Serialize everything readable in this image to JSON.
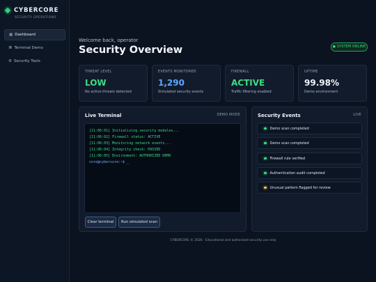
{
  "brand": {
    "name": "CYBERCORE",
    "subtitle": "SECURITY OPERATIONS",
    "accent": "#2bd27e"
  },
  "sidebar": {
    "items": [
      {
        "icon": "▦",
        "label": "Dashboard",
        "active": true
      },
      {
        "icon": "⌘",
        "label": "Terminal Demo",
        "active": false
      },
      {
        "icon": "⚙",
        "label": "Security Tools",
        "active": false
      }
    ]
  },
  "header": {
    "welcome": "Welcome back, operator",
    "title": "Security Overview",
    "status_badge": "● SYSTEM ONLINE"
  },
  "cards": [
    {
      "label": "THREAT LEVEL",
      "value": "LOW",
      "sub": "No active threats detected",
      "color": "#3ddc84"
    },
    {
      "label": "EVENTS MONITORED",
      "value": "1,290",
      "sub": "Simulated security events",
      "color": "#5fa8ff"
    },
    {
      "label": "FIREWALL",
      "value": "ACTIVE",
      "sub": "Traffic filtering enabled",
      "color": "#3ddc84"
    },
    {
      "label": "UPTIME",
      "value": "99.98%",
      "sub": "Demo environment",
      "color": "#f2f6fb"
    }
  ],
  "terminal": {
    "title": "Live Terminal",
    "mode": "DEMO MODE",
    "lines": [
      "[11:06:01] Initializing security modules...",
      "[11:06:02] Firewall status: ACTIVE",
      "[11:06:03] Monitoring network events...",
      "[11:06:04] Integrity check: PASSED",
      "[11:06:05] Environment: AUTHORIZED DEMO"
    ],
    "prompt": "core@cybercore:~$ _",
    "clear_label": "Clear terminal",
    "scan_label": "Run simulated scan"
  },
  "events": {
    "title": "Security Events",
    "tag": "LIVE",
    "items": [
      {
        "text": "Demo scan completed",
        "color": "#3ddc84"
      },
      {
        "text": "Demo scan completed",
        "color": "#3ddc84"
      },
      {
        "text": "Firewall rule verified",
        "color": "#3ddc84"
      },
      {
        "text": "Authentication audit completed",
        "color": "#3ddc84"
      },
      {
        "text": "Unusual pattern flagged for review",
        "color": "#f5c542"
      }
    ]
  },
  "footer": {
    "text": "CYBERCORE © 2026 · Educational and authorized security use only"
  }
}
